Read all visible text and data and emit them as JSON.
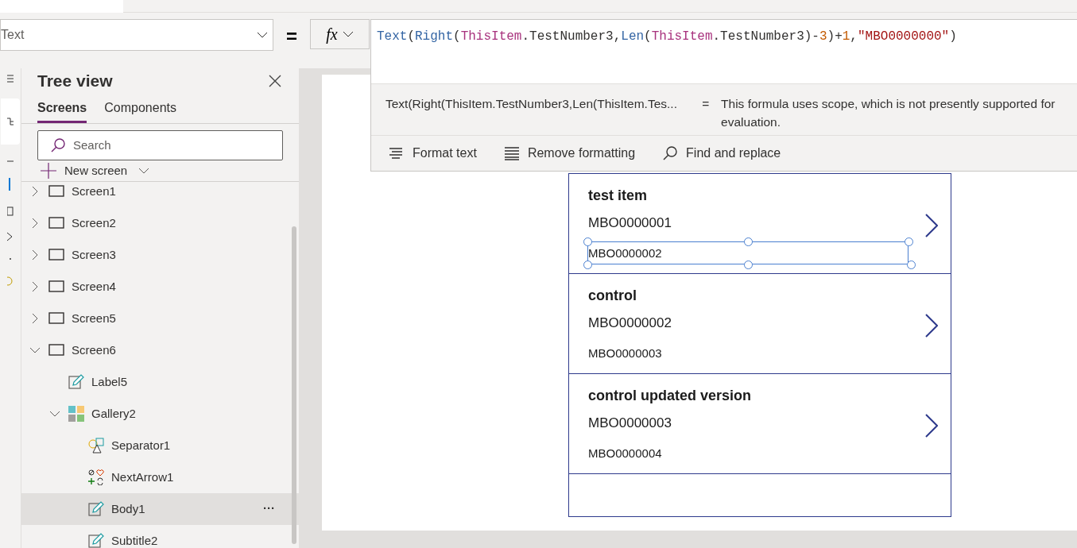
{
  "property_selector": {
    "value": "Text"
  },
  "equals_sign": "=",
  "fx_button": {
    "label": "fx"
  },
  "formula": [
    {
      "kind": "function",
      "text": "Text"
    },
    {
      "kind": "plain",
      "text": "("
    },
    {
      "kind": "function",
      "text": "Right"
    },
    {
      "kind": "plain",
      "text": "("
    },
    {
      "kind": "keyword",
      "text": "ThisItem"
    },
    {
      "kind": "plain",
      "text": ".TestNumber3,"
    },
    {
      "kind": "function",
      "text": "Len"
    },
    {
      "kind": "plain",
      "text": "("
    },
    {
      "kind": "keyword",
      "text": "ThisItem"
    },
    {
      "kind": "plain",
      "text": ".TestNumber3)-"
    },
    {
      "kind": "number",
      "text": "3"
    },
    {
      "kind": "plain",
      "text": ")+"
    },
    {
      "kind": "number",
      "text": "1"
    },
    {
      "kind": "plain",
      "text": ","
    },
    {
      "kind": "string",
      "text": "\"MBO0000000\""
    },
    {
      "kind": "plain",
      "text": ")"
    }
  ],
  "evaluation": {
    "expression": "Text(Right(ThisItem.TestNumber3,Len(ThisItem.Tes...",
    "equals": "=",
    "result": "This formula uses scope, which is not presently supported for evaluation."
  },
  "formula_toolbar": [
    {
      "kind": "format",
      "label": "Format text"
    },
    {
      "kind": "remove",
      "label": "Remove formatting"
    },
    {
      "kind": "find",
      "label": "Find and replace"
    }
  ],
  "tree_view": {
    "title": "Tree view",
    "tabs": [
      {
        "label": "Screens",
        "selected": true
      },
      {
        "label": "Components",
        "selected": false
      }
    ],
    "search": {
      "placeholder": "Search"
    },
    "new_screen": "New screen",
    "more_options": "···",
    "items": [
      {
        "label": "Screen1",
        "kind": "screen",
        "expanded": false,
        "selected": false
      },
      {
        "label": "Screen2",
        "kind": "screen",
        "expanded": false,
        "selected": false
      },
      {
        "label": "Screen3",
        "kind": "screen",
        "expanded": false,
        "selected": false
      },
      {
        "label": "Screen4",
        "kind": "screen",
        "expanded": false,
        "selected": false
      },
      {
        "label": "Screen5",
        "kind": "screen",
        "expanded": false,
        "selected": false
      },
      {
        "label": "Screen6",
        "kind": "screen",
        "expanded": true,
        "selected": false,
        "children": [
          {
            "label": "Label5",
            "kind": "label",
            "selected": false
          },
          {
            "label": "Gallery2",
            "kind": "gallery",
            "expanded": true,
            "selected": false,
            "children": [
              {
                "label": "Separator1",
                "kind": "shape",
                "selected": false
              },
              {
                "label": "NextArrow1",
                "kind": "icons",
                "selected": false
              },
              {
                "label": "Body1",
                "kind": "label",
                "selected": true
              },
              {
                "label": "Subtitle2",
                "kind": "label",
                "selected": false
              }
            ]
          }
        ]
      }
    ]
  },
  "gallery": [
    {
      "title": "test item",
      "subtitle": "MBO0000001",
      "body": "MBO0000002",
      "selected": true
    },
    {
      "title": "control",
      "subtitle": "MBO0000002",
      "body": "MBO0000003",
      "selected": false
    },
    {
      "title": "control updated version",
      "subtitle": "MBO0000003",
      "body": "MBO0000004",
      "selected": false
    }
  ]
}
